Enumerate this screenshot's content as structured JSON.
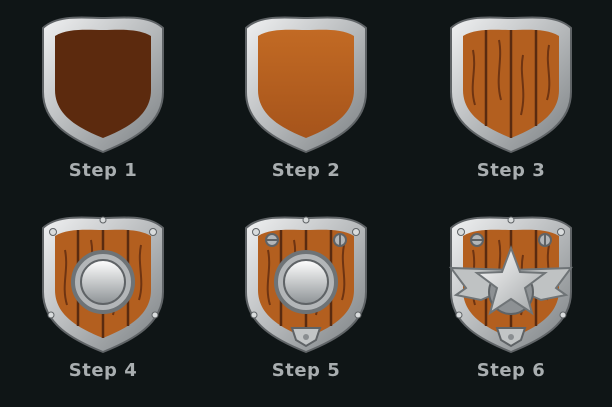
{
  "colors": {
    "background": "#0f1516",
    "label": "#a9aeb0",
    "frame_light": "#d7d9da",
    "frame_dark": "#6e7376",
    "wood_dark": "#5a2a0f",
    "wood_light": "#c46a24",
    "plank": "#b45f1f",
    "metal": "#c9cbcc"
  },
  "steps": [
    {
      "label": "Step 1",
      "icon": "plain-shield-dark-icon"
    },
    {
      "label": "Step 2",
      "icon": "plain-shield-light-icon"
    },
    {
      "label": "Step 3",
      "icon": "wood-plank-shield-icon"
    },
    {
      "label": "Step 4",
      "icon": "shield-with-boss-icon"
    },
    {
      "label": "Step 5",
      "icon": "shield-with-boss-and-bolts-icon"
    },
    {
      "label": "Step 6",
      "icon": "shield-with-star-emblem-icon"
    }
  ]
}
